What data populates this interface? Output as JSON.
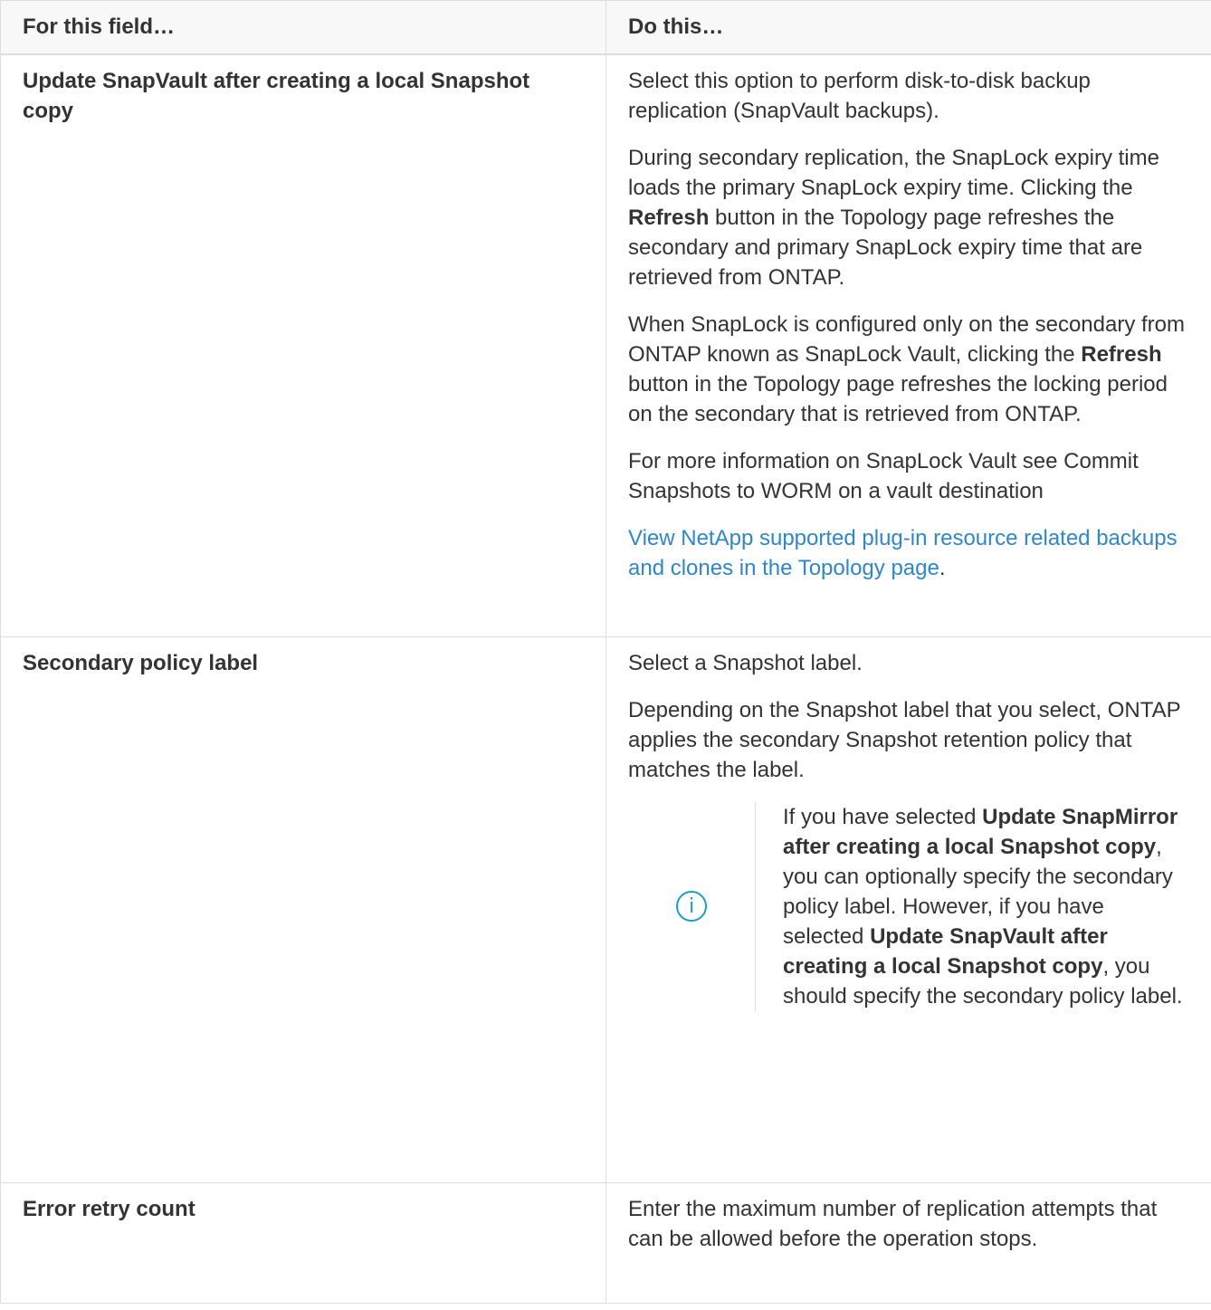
{
  "header": {
    "col_field": "For this field…",
    "col_action": "Do this…"
  },
  "rows": [
    {
      "field": "Update SnapVault after creating a local Snapshot copy",
      "p1": "Select this option to perform disk-to-disk backup replication (SnapVault backups).",
      "p2_a": "During secondary replication, the SnapLock expiry time loads the primary SnapLock expiry time. Clicking the ",
      "p2_b": "Refresh",
      "p2_c": " button in the Topology page refreshes the secondary and primary SnapLock expiry time that are retrieved from ONTAP.",
      "p3_a": "When SnapLock is configured only on the secondary from ONTAP known as SnapLock Vault, clicking the ",
      "p3_b": "Refresh",
      "p3_c": " button in the Topology page refreshes the locking period on the secondary that is retrieved from ONTAP.",
      "p4": "For more information on SnapLock Vault see Commit Snapshots to WORM on a vault destination",
      "link": "View NetApp supported plug-in resource related backups and clones in the Topology page",
      "link_suffix": "."
    },
    {
      "field": "Secondary policy label",
      "p1": "Select a Snapshot label.",
      "p2": "Depending on the Snapshot label that you select, ONTAP applies the secondary Snapshot retention policy that matches the label.",
      "note": {
        "icon": "info-icon",
        "icon_glyph": "i",
        "t1": "If you have selected ",
        "b1": "Update SnapMirror after creating a local Snapshot copy",
        "t2": ", you can optionally specify the secondary policy label. However, if you have selected ",
        "b2": "Update SnapVault after creating a local Snapshot copy",
        "t3": ", you should specify the secondary policy label."
      }
    },
    {
      "field": "Error retry count",
      "p1": "Enter the maximum number of replication attempts that can be allowed before the operation stops."
    }
  ],
  "colors": {
    "link": "#2e87c8",
    "info_icon": "#19a0c3",
    "header_bg": "#f7f8f7",
    "border": "#dedede"
  }
}
